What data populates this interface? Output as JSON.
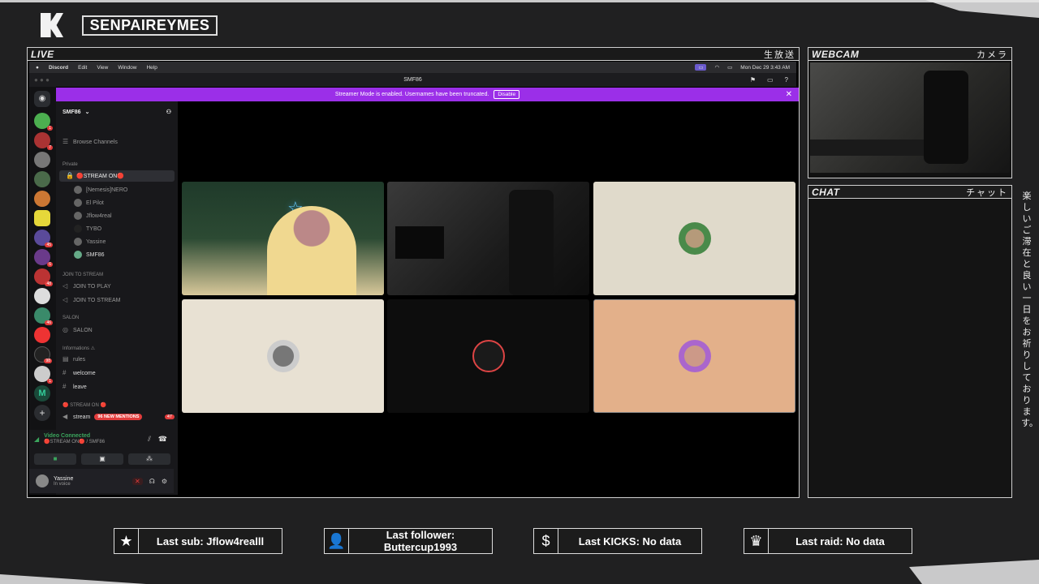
{
  "overlay": {
    "channel_name": "SENPAIREYMES",
    "live_label": "LIVE",
    "live_jp": "生放送",
    "webcam_label": "WEBCAM",
    "webcam_jp": "カメラ",
    "chat_label": "CHAT",
    "chat_jp": "チャット",
    "side_jp": "楽しいご滞在と良い一日をお祈りしております。",
    "stats": {
      "last_sub": "Last sub: Jflow4realll",
      "last_follower": "Last follower: Buttercup1993",
      "last_kicks": "Last KICKS: No data",
      "last_raid": "Last raid: No data"
    }
  },
  "macos": {
    "menu": [
      "Discord",
      "Edit",
      "View",
      "Window",
      "Help"
    ],
    "clock": "Mon Dec 29  3:43 AM"
  },
  "discord": {
    "window_title": "SMF86",
    "streamer_mode_text": "Streamer Mode is enabled. Usernames have been truncated.",
    "disable_label": "Disable",
    "server_name": "SMF86",
    "browse_channels": "Browse Channels",
    "category_private": "Private",
    "stream_channel": "🔴STREAM ON🔴",
    "members": [
      "[Nemesis]NERO",
      "El Pilot",
      "Jflow4real",
      "TYBO",
      "Yassine",
      "SMF86"
    ],
    "category_join": "JOIN TO STREAM",
    "join_channels": [
      "JOIN TO PLAY",
      "JOIN TO STREAM"
    ],
    "category_salon": "SALON",
    "salon_channel": "SALON",
    "category_info": "Informations ⚠",
    "info_channels": [
      "rules",
      "welcome",
      "leave"
    ],
    "category_stream": "🔴 STREAM ON 🔴",
    "stream_text_channel": "stream",
    "mentions": "96 NEW MENTIONS",
    "mentions_count": "47",
    "voice_status": "Video Connected",
    "voice_channel": "🔴STREAM ON🔴 / SMF86",
    "username": "Yassine",
    "user_status": "In voice"
  },
  "colors": {
    "accent": "#9b2fe8",
    "connected": "#3ba55d"
  }
}
